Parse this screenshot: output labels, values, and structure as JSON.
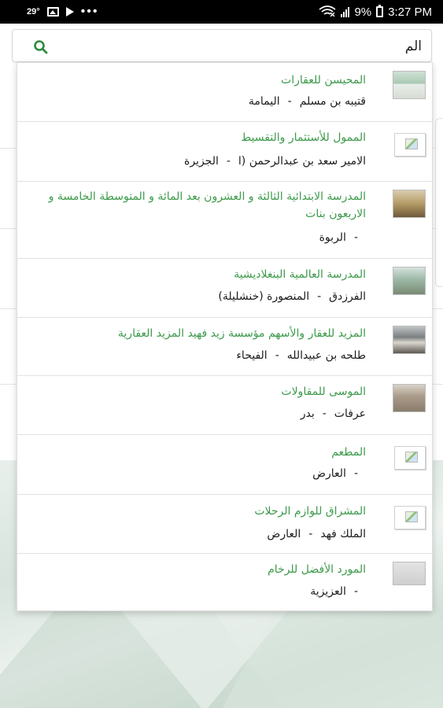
{
  "status_bar": {
    "temperature": "29°",
    "battery_percent": "9%",
    "time": "3:27 PM"
  },
  "search": {
    "value": "الم",
    "placeholder": ""
  },
  "results": [
    {
      "title": "المحيسن للعقارات",
      "street": "قتيبه بن مسلم",
      "district": "اليمامة",
      "thumb": "photo"
    },
    {
      "title": "الممول للأستثمار والتقسيط",
      "street": "الامير سعد بن عبدالرحمن (ا",
      "district": "الجزيرة",
      "thumb": "broken"
    },
    {
      "title": "المدرسة الابتدائية الثالثة و العشرون بعد المائة و المتوسطة الخامسة و الاربعون بنات",
      "street": "",
      "district": "الربوة",
      "thumb": "photo"
    },
    {
      "title": "المدرسة العالمية البنغلاديشية",
      "street": "الفرزدق",
      "district": "المنصورة (خنشليلة)",
      "thumb": "photo"
    },
    {
      "title": "المزيد للعقار والأسهم مؤسسة زيد فهيد المزيد العقارية",
      "street": "طلحه بن عبيدالله",
      "district": "الفيحاء",
      "thumb": "photo"
    },
    {
      "title": "الموسى للمقاولات",
      "street": "عرفات",
      "district": "بدر",
      "thumb": "photo"
    },
    {
      "title": "المطعم",
      "street": "",
      "district": "العارض",
      "thumb": "broken"
    },
    {
      "title": "المشراق للوازم الرحلات",
      "street": "الملك فهد",
      "district": "العارض",
      "thumb": "broken"
    },
    {
      "title": "المورد الأفضل للرخام",
      "street": "",
      "district": "العزيزية",
      "thumb": "photo"
    }
  ],
  "separator": "-",
  "colors": {
    "accent_green": "#3c9a4a",
    "search_icon": "#2e8b3e",
    "status_bar": "#000000"
  }
}
